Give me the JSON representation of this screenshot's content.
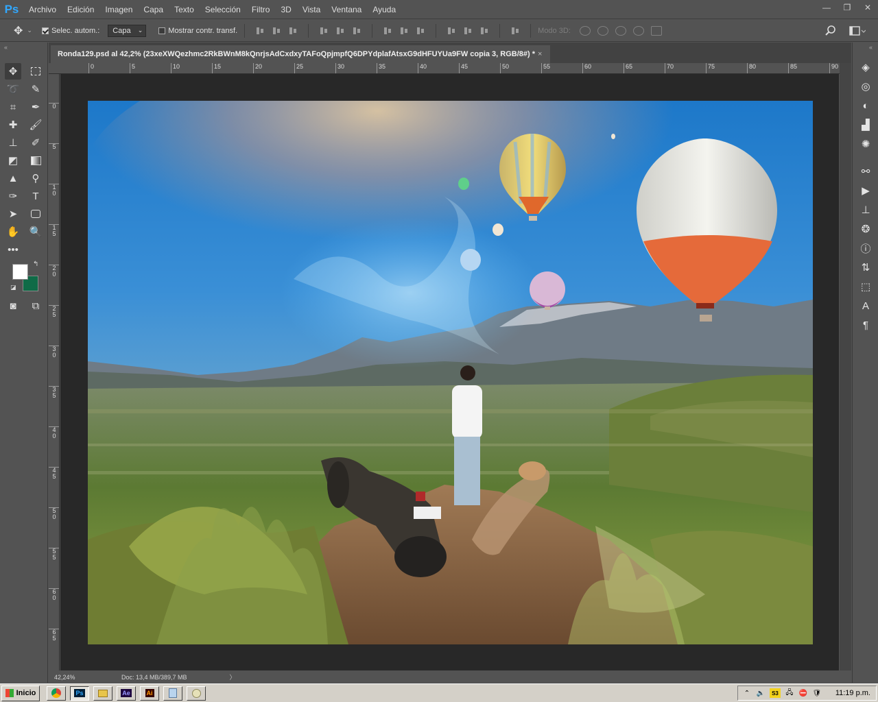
{
  "app": {
    "logo": "Ps",
    "menu": [
      "Archivo",
      "Edición",
      "Imagen",
      "Capa",
      "Texto",
      "Selección",
      "Filtro",
      "3D",
      "Vista",
      "Ventana",
      "Ayuda"
    ]
  },
  "options": {
    "auto_select_label": "Selec. autom.:",
    "auto_select_checked": true,
    "target_value": "Capa",
    "show_transform_label": "Mostrar contr. transf.",
    "show_transform_checked": false,
    "mode_3d_label": "Modo 3D:"
  },
  "document": {
    "tab_title": "Ronda129.psd al 42,2% (23xeXWQezhmc2RkBWnM8kQnrjsAdCxdxyTAFoQpjmpfQ6DPYdplafAtsxG9dHFUYUa9FW copia 3, RGB/8#) *",
    "close_glyph": "×"
  },
  "ruler_h": [
    "0",
    "5",
    "10",
    "15",
    "20",
    "25",
    "30",
    "35",
    "40",
    "45",
    "50",
    "55",
    "60",
    "65",
    "70",
    "75",
    "80",
    "85",
    "90"
  ],
  "ruler_v": [
    "0",
    "5",
    "1\n0",
    "1\n5",
    "2\n0",
    "2\n5",
    "3\n0",
    "3\n5",
    "4\n0",
    "4\n5",
    "5\n0",
    "5\n5",
    "6\n0",
    "6\n5"
  ],
  "status": {
    "zoom": "42,24%",
    "doc_size": "Doc: 13,4 MB/389,7 MB",
    "arrow": "〉"
  },
  "colors": {
    "foreground": "#ffffff",
    "background": "#0f6b47",
    "ps_blue": "#31a8ff"
  },
  "taskbar": {
    "start_label": "Inicio",
    "apps": [
      "chrome-icon",
      "ps-icon",
      "explorer-icon",
      "ae-icon",
      "ai-icon",
      "notepad-icon",
      "paint-icon"
    ],
    "ae_label": "Ae",
    "ai_label": "Ai",
    "ps_label": "Ps",
    "tray_badge": "S3",
    "clock": "11:19 p.m."
  }
}
